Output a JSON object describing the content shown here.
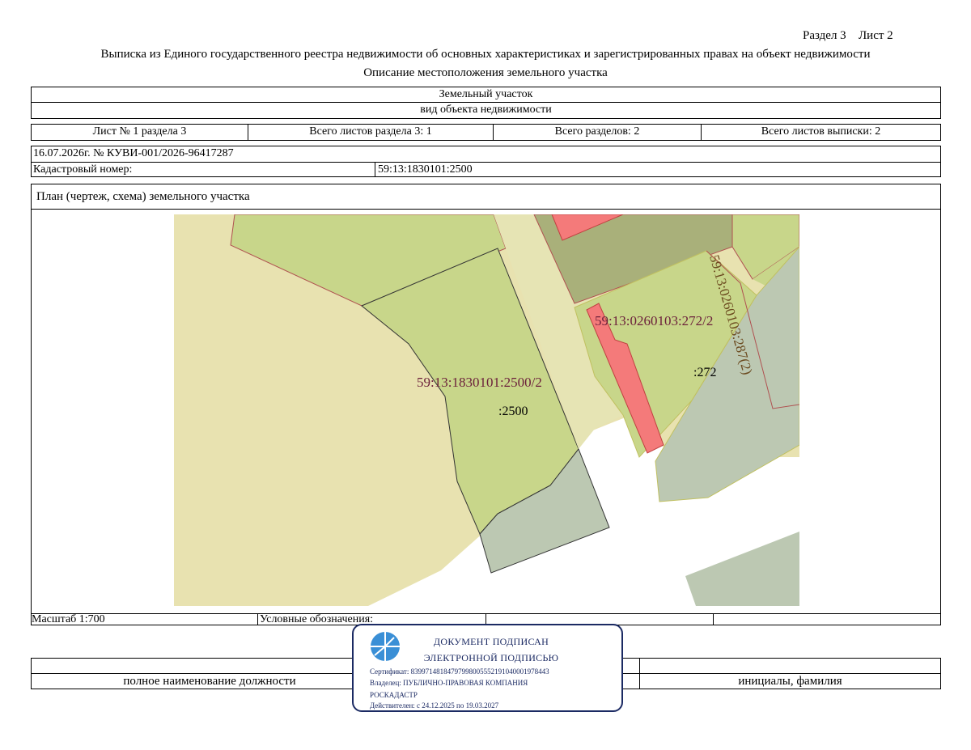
{
  "header": {
    "section_label": "Раздел 3",
    "sheet_label": "Лист 2",
    "title": "Выписка из Единого государственного реестра недвижимости об основных характеристиках и зарегистрированных правах на объект недвижимости",
    "subtitle": "Описание местоположения земельного участка"
  },
  "object": {
    "name": "Земельный участок",
    "kind_caption": "вид объекта недвижимости"
  },
  "sheets": {
    "sheet_no": "Лист № 1 раздела 3",
    "total_sheets_section": "Всего листов раздела 3: 1",
    "total_sections": "Всего разделов: 2",
    "total_sheets_extract": "Всего листов выписки: 2"
  },
  "record": {
    "date_number": "16.07.2026г. № КУВИ-001/2026-96417287",
    "cadastral_label": "Кадастровый номер:",
    "cadastral_value": "59:13:1830101:2500"
  },
  "plan": {
    "heading": "План (чертеж, схема) земельного участка",
    "labels": {
      "main_parcel": "59:13:1830101:2500/2",
      "main_short": ":2500",
      "neighbor_parcel": "59:13:0260103:272/2",
      "neighbor_short": ":272",
      "vertical_parcel": "59:13:0260103:287(2)"
    },
    "colors": {
      "background_land": "#e8e2b0",
      "parcel_green": "#c8d68a",
      "dark_olive": "#a9b07a",
      "grey_parcel": "#bcc8b2",
      "building_red": "#f47a7a",
      "road": "#e6e4b4"
    }
  },
  "footer_row": {
    "scale": "Масштаб 1:700",
    "legend": "Условные обозначения:"
  },
  "signature": {
    "position_caption": "полное наименование должности",
    "name_caption": "инициалы, фамилия"
  },
  "stamp": {
    "line1": "ДОКУМЕНТ ПОДПИСАН",
    "line2": "ЭЛЕКТРОННОЙ ПОДПИСЬЮ",
    "certificate": "Сертификат: 839971481847979980055521910400019784​43",
    "owner": "Владелец: ПУБЛИЧНО-ПРАВОВАЯ КОМПАНИЯ",
    "owner2": "РОСКАДАСТР",
    "validity": "Действителен: с 24.12.2025 по 19.03.2027",
    "logo_icon": "roskadastr-logo-icon"
  }
}
